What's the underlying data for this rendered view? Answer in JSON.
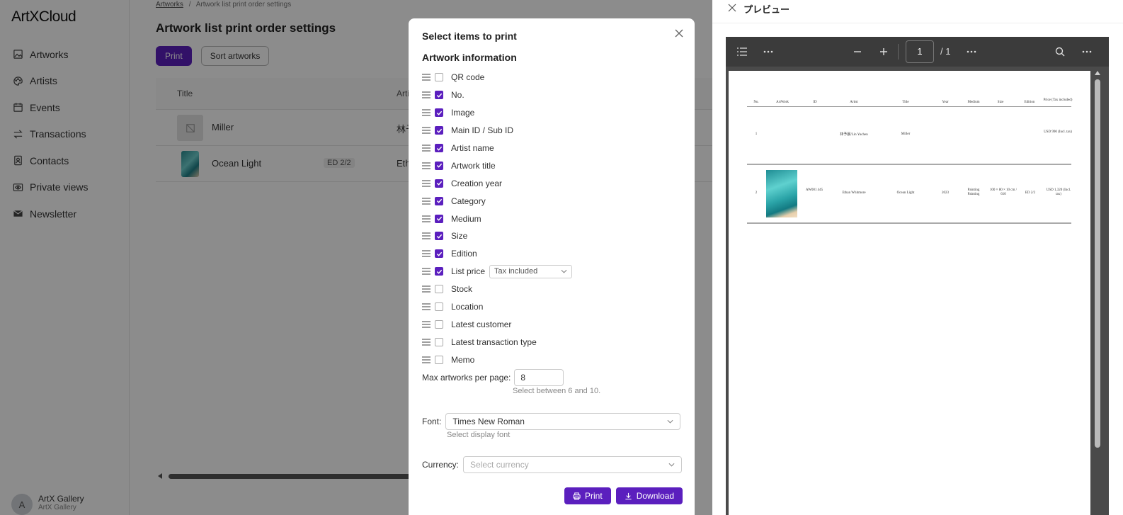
{
  "sidebar": {
    "logo": "ArtXCloud",
    "items": [
      {
        "label": "Artworks",
        "icon": "image-icon"
      },
      {
        "label": "Artists",
        "icon": "palette-icon"
      },
      {
        "label": "Events",
        "icon": "calendar-icon"
      },
      {
        "label": "Transactions",
        "icon": "transfer-icon"
      },
      {
        "label": "Contacts",
        "icon": "contact-icon"
      },
      {
        "label": "Private views",
        "icon": "eye-icon"
      },
      {
        "label": "Newsletter",
        "icon": "mail-icon"
      }
    ],
    "account": {
      "initial": "A",
      "name": "ArtX Gallery",
      "sub": "ArtX Gallery"
    }
  },
  "main": {
    "breadcrumb": {
      "link": "Artworks",
      "separator": "/",
      "current": "Artwork list print order settings"
    },
    "title": "Artwork list print order settings",
    "print_label": "Print",
    "sort_label": "Sort artworks",
    "table": {
      "headers": {
        "title": "Title",
        "artist": "Arti"
      },
      "rows": [
        {
          "title": "Miller",
          "edition": "",
          "artist": "林予"
        },
        {
          "title": "Ocean Light",
          "edition": "ED 2/2",
          "artist": "Eth"
        }
      ]
    }
  },
  "modal": {
    "title": "Select items to print",
    "section": "Artwork information",
    "items": [
      {
        "label": "QR code",
        "checked": false
      },
      {
        "label": "No.",
        "checked": true
      },
      {
        "label": "Image",
        "checked": true
      },
      {
        "label": "Main ID / Sub ID",
        "checked": true
      },
      {
        "label": "Artist name",
        "checked": true
      },
      {
        "label": "Artwork title",
        "checked": true
      },
      {
        "label": "Creation year",
        "checked": true
      },
      {
        "label": "Category",
        "checked": true
      },
      {
        "label": "Medium",
        "checked": true
      },
      {
        "label": "Size",
        "checked": true
      },
      {
        "label": "Edition",
        "checked": true
      },
      {
        "label": "List price",
        "checked": true,
        "select": "Tax included"
      },
      {
        "label": "Stock",
        "checked": false
      },
      {
        "label": "Location",
        "checked": false
      },
      {
        "label": "Latest customer",
        "checked": false
      },
      {
        "label": "Latest transaction type",
        "checked": false
      },
      {
        "label": "Memo",
        "checked": false
      }
    ],
    "max_label": "Max artworks per page:",
    "max_value": "8",
    "max_help": "Select between 6 and 10.",
    "font_label": "Font:",
    "font_value": "Times New Roman",
    "font_help": "Select display font",
    "currency_label": "Currency:",
    "currency_placeholder": "Select currency",
    "print_label": "Print",
    "download_label": "Download"
  },
  "preview": {
    "title": "プレビュー",
    "page_current": "1",
    "page_total": "/ 1",
    "pdf": {
      "headers": {
        "no": "No.",
        "artwork": "ArtWork",
        "id": "ID",
        "artist": "Artist",
        "title": "Title",
        "year": "Year",
        "medium": "Medium",
        "size": "Size",
        "edition": "Edition",
        "price": "Price (Tax included)"
      },
      "rows": [
        {
          "no": "1",
          "id": "",
          "artist": "林予晨/Lin Yuchen",
          "title": "Miller",
          "year": "",
          "medium": "",
          "size": "",
          "edition": "",
          "price": "USD 990 (Incl. tax)"
        },
        {
          "no": "2",
          "id": "AW001 445",
          "artist": "Ethan Whitmore",
          "title": "Ocean Light",
          "year": "2023",
          "medium": "Painting Painting",
          "size": "100 × 80 × 10 cm / 610",
          "edition": "ED 2/2",
          "price": "USD 1,320 (Incl. tax)"
        }
      ]
    }
  },
  "colors": {
    "accent": "#5b1fbe",
    "overlay": "rgba(0,0,0,0.45)",
    "viewer_bg": "#4a4a4a"
  }
}
